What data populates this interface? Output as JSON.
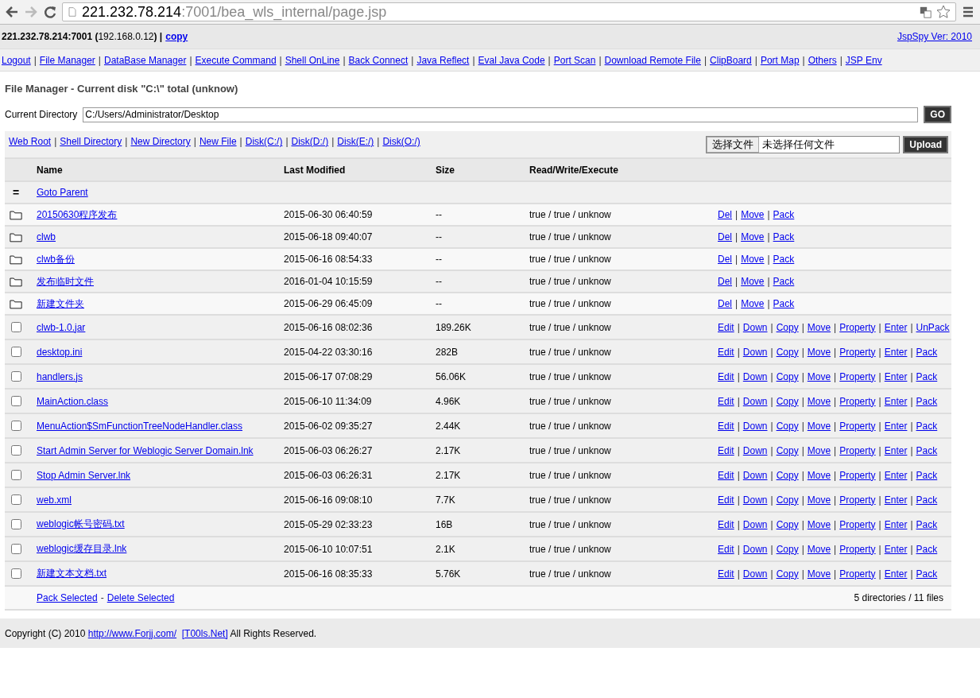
{
  "browser": {
    "url_host": "221.232.78.214",
    "url_rest": ":7001/bea_wls_internal/page.jsp"
  },
  "header": {
    "host": "**221.232.78.214:7001 (**192.168.0.12**) |**",
    "copy": "copy",
    "version": "JspSpy Ver: 2010"
  },
  "nav": [
    "Logout",
    "|",
    "File Manager",
    "|",
    "DataBase Manager",
    "|",
    "Execute Command",
    "|",
    "Shell OnLine",
    "|",
    "Back Connect",
    "|",
    "Java Reflect",
    "|",
    "Eval Java Code",
    "|",
    "Port Scan",
    "|",
    "Download Remote File",
    "|",
    "ClipBoard",
    "|",
    "Port Map",
    "|",
    "Others",
    "|",
    "JSP Env"
  ],
  "title": "File Manager - Current disk \"C:\\\" total (unknow)",
  "directory": {
    "label": "Current Directory",
    "value": "C:/Users/Administrator/Desktop",
    "button": "GO"
  },
  "toolbar": [
    "Web Root",
    "|",
    "Shell Directory",
    "|",
    "New Directory",
    "|",
    "New File",
    "|",
    "Disk(C:/)",
    "|",
    "Disk(D:/)",
    "|",
    "Disk(E:/)",
    "|",
    "Disk(O:/)"
  ],
  "upload": {
    "choose": "选择文件",
    "status": "未选择任何文件",
    "button": "Upload"
  },
  "table": {
    "columns": [
      "Name",
      "Last Modified",
      "Size",
      "Read/Write/Execute"
    ],
    "rows": [
      {
        "kind": "parent",
        "icon": "=",
        "name": "Goto Parent"
      },
      {
        "kind": "dir",
        "name": "20150630程序发布",
        "modified": "2015-06-30 06:40:59",
        "size": "--",
        "rwx": "true / true / unknow",
        "actions": [
          "Del",
          "|",
          "Move",
          "|",
          "Pack"
        ]
      },
      {
        "kind": "dir",
        "name": "clwb",
        "modified": "2015-06-18 09:40:07",
        "size": "--",
        "rwx": "true / true / unknow",
        "actions": [
          "Del",
          "|",
          "Move",
          "|",
          "Pack"
        ]
      },
      {
        "kind": "dir",
        "name": "clwb备份",
        "modified": "2015-06-16 08:54:33",
        "size": "--",
        "rwx": "true / true / unknow",
        "actions": [
          "Del",
          "|",
          "Move",
          "|",
          "Pack"
        ]
      },
      {
        "kind": "dir",
        "name": "发布临时文件",
        "modified": "2016-01-04 10:15:59",
        "size": "--",
        "rwx": "true / true / unknow",
        "actions": [
          "Del",
          "|",
          "Move",
          "|",
          "Pack"
        ]
      },
      {
        "kind": "dir",
        "name": "新建文件夹",
        "modified": "2015-06-29 06:45:09",
        "size": "--",
        "rwx": "true / true / unknow",
        "actions": [
          "Del",
          "|",
          "Move",
          "|",
          "Pack"
        ]
      },
      {
        "kind": "file",
        "checked": false,
        "name": "clwb-1.0.jar",
        "modified": "2015-06-16 08:02:36",
        "size": "189.26K",
        "rwx": "true / true / unknow",
        "actions": [
          "Edit",
          "|",
          "Down",
          "|",
          "Copy",
          "|",
          "Move",
          "|",
          "Property",
          "|",
          "Enter",
          "|",
          "UnPack"
        ]
      },
      {
        "kind": "file",
        "checked": false,
        "name": "desktop.ini",
        "modified": "2015-04-22 03:30:16",
        "size": "282B",
        "rwx": "true / true / unknow",
        "actions": [
          "Edit",
          "|",
          "Down",
          "|",
          "Copy",
          "|",
          "Move",
          "|",
          "Property",
          "|",
          "Enter",
          "|",
          "Pack"
        ]
      },
      {
        "kind": "file",
        "checked": false,
        "name": "handlers.js",
        "modified": "2015-06-17 07:08:29",
        "size": "56.06K",
        "rwx": "true / true / unknow",
        "actions": [
          "Edit",
          "|",
          "Down",
          "|",
          "Copy",
          "|",
          "Move",
          "|",
          "Property",
          "|",
          "Enter",
          "|",
          "Pack"
        ]
      },
      {
        "kind": "file",
        "checked": false,
        "name": "MainAction.class",
        "modified": "2015-06-10 11:34:09",
        "size": "4.96K",
        "rwx": "true / true / unknow",
        "actions": [
          "Edit",
          "|",
          "Down",
          "|",
          "Copy",
          "|",
          "Move",
          "|",
          "Property",
          "|",
          "Enter",
          "|",
          "Pack"
        ]
      },
      {
        "kind": "file",
        "checked": false,
        "name": "MenuAction$SmFunctionTreeNodeHandler.class",
        "modified": "2015-06-02 09:35:27",
        "size": "2.44K",
        "rwx": "true / true / unknow",
        "actions": [
          "Edit",
          "|",
          "Down",
          "|",
          "Copy",
          "|",
          "Move",
          "|",
          "Property",
          "|",
          "Enter",
          "|",
          "Pack"
        ]
      },
      {
        "kind": "file",
        "checked": false,
        "name": "Start Admin Server for Weblogic Server Domain.lnk",
        "modified": "2015-06-03 06:26:27",
        "size": "2.17K",
        "rwx": "true / true / unknow",
        "actions": [
          "Edit",
          "|",
          "Down",
          "|",
          "Copy",
          "|",
          "Move",
          "|",
          "Property",
          "|",
          "Enter",
          "|",
          "Pack"
        ]
      },
      {
        "kind": "file",
        "checked": false,
        "name": "Stop Admin Server.lnk",
        "modified": "2015-06-03 06:26:31",
        "size": "2.17K",
        "rwx": "true / true / unknow",
        "actions": [
          "Edit",
          "|",
          "Down",
          "|",
          "Copy",
          "|",
          "Move",
          "|",
          "Property",
          "|",
          "Enter",
          "|",
          "Pack"
        ]
      },
      {
        "kind": "file",
        "checked": false,
        "name": "web.xml",
        "modified": "2015-06-16 09:08:10",
        "size": "7.7K",
        "rwx": "true / true / unknow",
        "actions": [
          "Edit",
          "|",
          "Down",
          "|",
          "Copy",
          "|",
          "Move",
          "|",
          "Property",
          "|",
          "Enter",
          "|",
          "Pack"
        ]
      },
      {
        "kind": "file",
        "checked": false,
        "name": "weblogic帐号密码.txt",
        "modified": "2015-05-29 02:33:23",
        "size": "16B",
        "rwx": "true / true / unknow",
        "actions": [
          "Edit",
          "|",
          "Down",
          "|",
          "Copy",
          "|",
          "Move",
          "|",
          "Property",
          "|",
          "Enter",
          "|",
          "Pack"
        ]
      },
      {
        "kind": "file",
        "checked": false,
        "name": "weblogic缓存目录.lnk",
        "modified": "2015-06-10 10:07:51",
        "size": "2.1K",
        "rwx": "true / true / unknow",
        "actions": [
          "Edit",
          "|",
          "Down",
          "|",
          "Copy",
          "|",
          "Move",
          "|",
          "Property",
          "|",
          "Enter",
          "|",
          "Pack"
        ]
      },
      {
        "kind": "file",
        "checked": false,
        "name": "新建文本文档.txt",
        "modified": "2015-06-16 08:35:33",
        "size": "5.76K",
        "rwx": "true / true / unknow",
        "actions": [
          "Edit",
          "|",
          "Down",
          "|",
          "Copy",
          "|",
          "Move",
          "|",
          "Property",
          "|",
          "Enter",
          "|",
          "Pack"
        ]
      }
    ],
    "footer": {
      "links": [
        "Pack Selected",
        "-",
        "Delete Selected"
      ],
      "summary": "5 directories / 11 files"
    }
  },
  "copyright": {
    "before": "Copyright (C) 2010",
    "link1": "http://www.Forjj.com/",
    "link2": "[T00ls.Net]",
    "after": "All Rights Reserved."
  }
}
